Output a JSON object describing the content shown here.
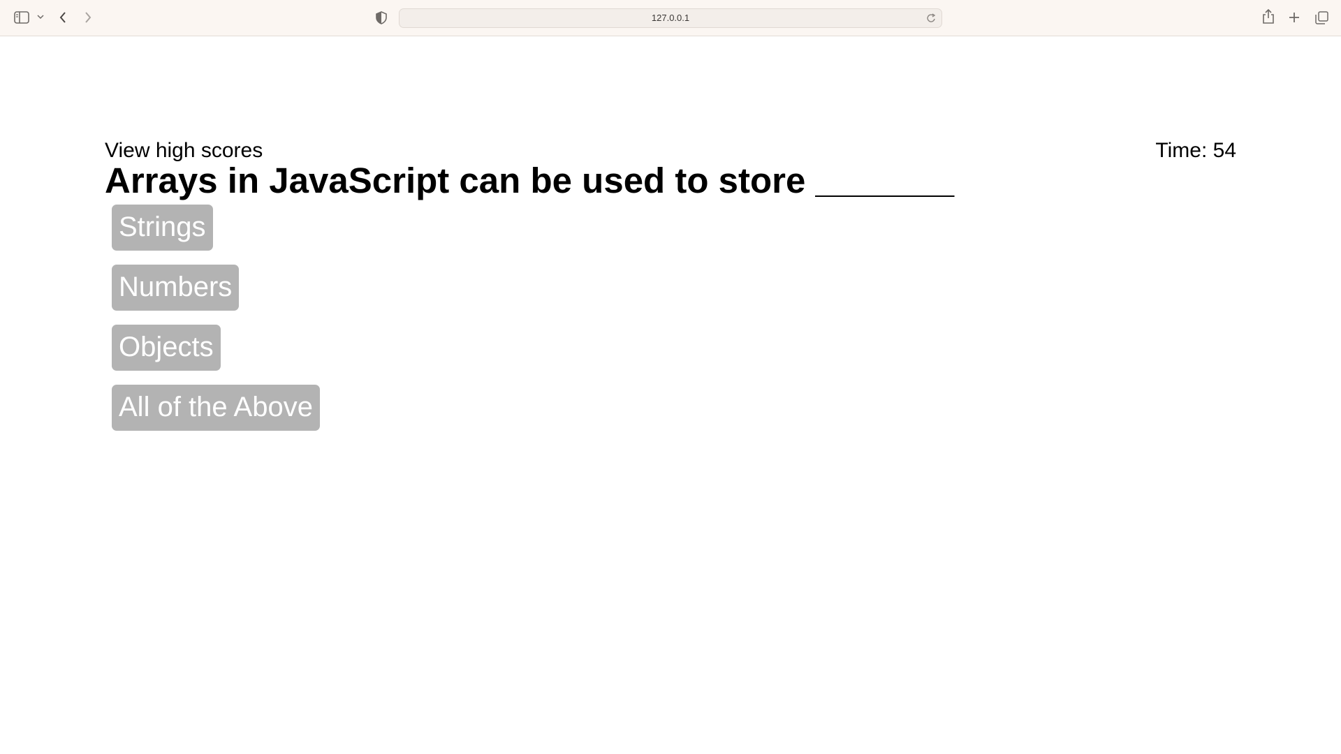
{
  "browser": {
    "url": "127.0.0.1",
    "icons": [
      "sidebar-icon",
      "chevron-down-icon",
      "back-icon",
      "forward-icon",
      "shield-icon",
      "reload-icon",
      "share-icon",
      "new-tab-icon",
      "tabs-overview-icon"
    ]
  },
  "quiz": {
    "high_scores_link": "View high scores",
    "timer": "Time: 54",
    "question": "Arrays in JavaScript can be used to store _______",
    "choices": [
      {
        "label": "Strings"
      },
      {
        "label": "Numbers"
      },
      {
        "label": "Objects"
      },
      {
        "label": "All of the Above"
      }
    ]
  },
  "colors": {
    "toolbar_bg": "#fbf6f2",
    "button_bg": "#b3b3b3",
    "button_text": "#ffffff"
  }
}
